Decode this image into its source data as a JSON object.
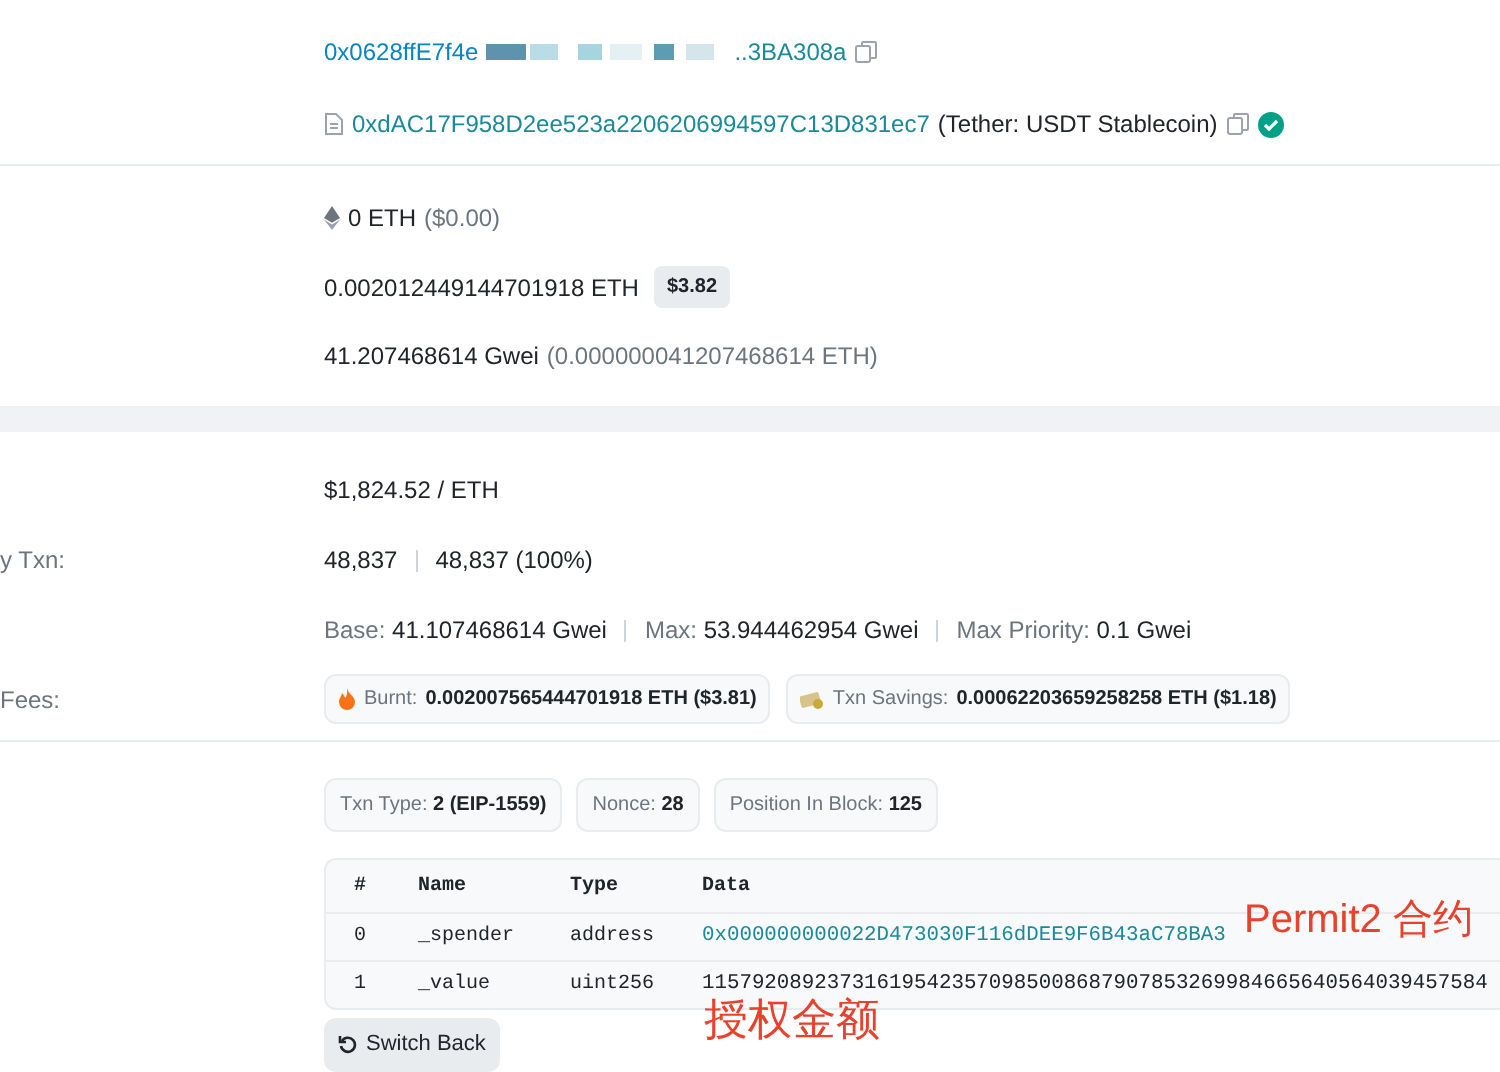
{
  "from_address": {
    "start": "0x0628ffE7f4e",
    "end": "..3BA308a"
  },
  "to_address": {
    "address": "0xdAC17F958D2ee523a2206206994597C13D831ec7",
    "label": "(Tether: USDT Stablecoin)",
    "verified": true
  },
  "value": {
    "amount": "0 ETH",
    "usd": "($0.00)"
  },
  "fee": {
    "amount": "0.002012449144701918 ETH",
    "usd": "$3.82"
  },
  "gas_price": {
    "gwei": "41.207468614 Gwei",
    "eth": "(0.000000041207468614 ETH)"
  },
  "ether_price": "$1,824.52 / ETH",
  "gas_usage": {
    "label": "y Txn:",
    "limit": "48,837",
    "used": "48,837 (100%)"
  },
  "gas_fees": [
    {
      "label": "Base:",
      "value": "41.107468614 Gwei"
    },
    {
      "label": "Max:",
      "value": "53.944462954 Gwei"
    },
    {
      "label": "Max Priority:",
      "value": "0.1 Gwei"
    }
  ],
  "burnt_fees": {
    "label": "Fees:",
    "items": [
      {
        "kind": "burnt",
        "label": "Burnt:",
        "value": "0.002007565444701918 ETH ($3.81)"
      },
      {
        "kind": "savings",
        "label": "Txn Savings:",
        "value": "0.00062203659258258 ETH ($1.18)"
      }
    ]
  },
  "attributes": [
    {
      "label": "Txn Type:",
      "value": "2 (EIP-1559)"
    },
    {
      "label": "Nonce:",
      "value": "28"
    },
    {
      "label": "Position In Block:",
      "value": "125"
    }
  ],
  "input_table": {
    "columns": [
      "#",
      "Name",
      "Type",
      "Data"
    ],
    "rows": [
      {
        "index": "0",
        "name": "_spender",
        "type": "address",
        "data": "0x000000000022D473030F116dDEE9F6B43aC78BA3",
        "kind": "address"
      },
      {
        "index": "1",
        "name": "_value",
        "type": "uint256",
        "data": "115792089237316195423570985008687907853269984665640564039457584",
        "kind": "number"
      }
    ]
  },
  "switch_button": "Switch Back",
  "annotations": [
    "Permit2 合约",
    "授权金额"
  ]
}
